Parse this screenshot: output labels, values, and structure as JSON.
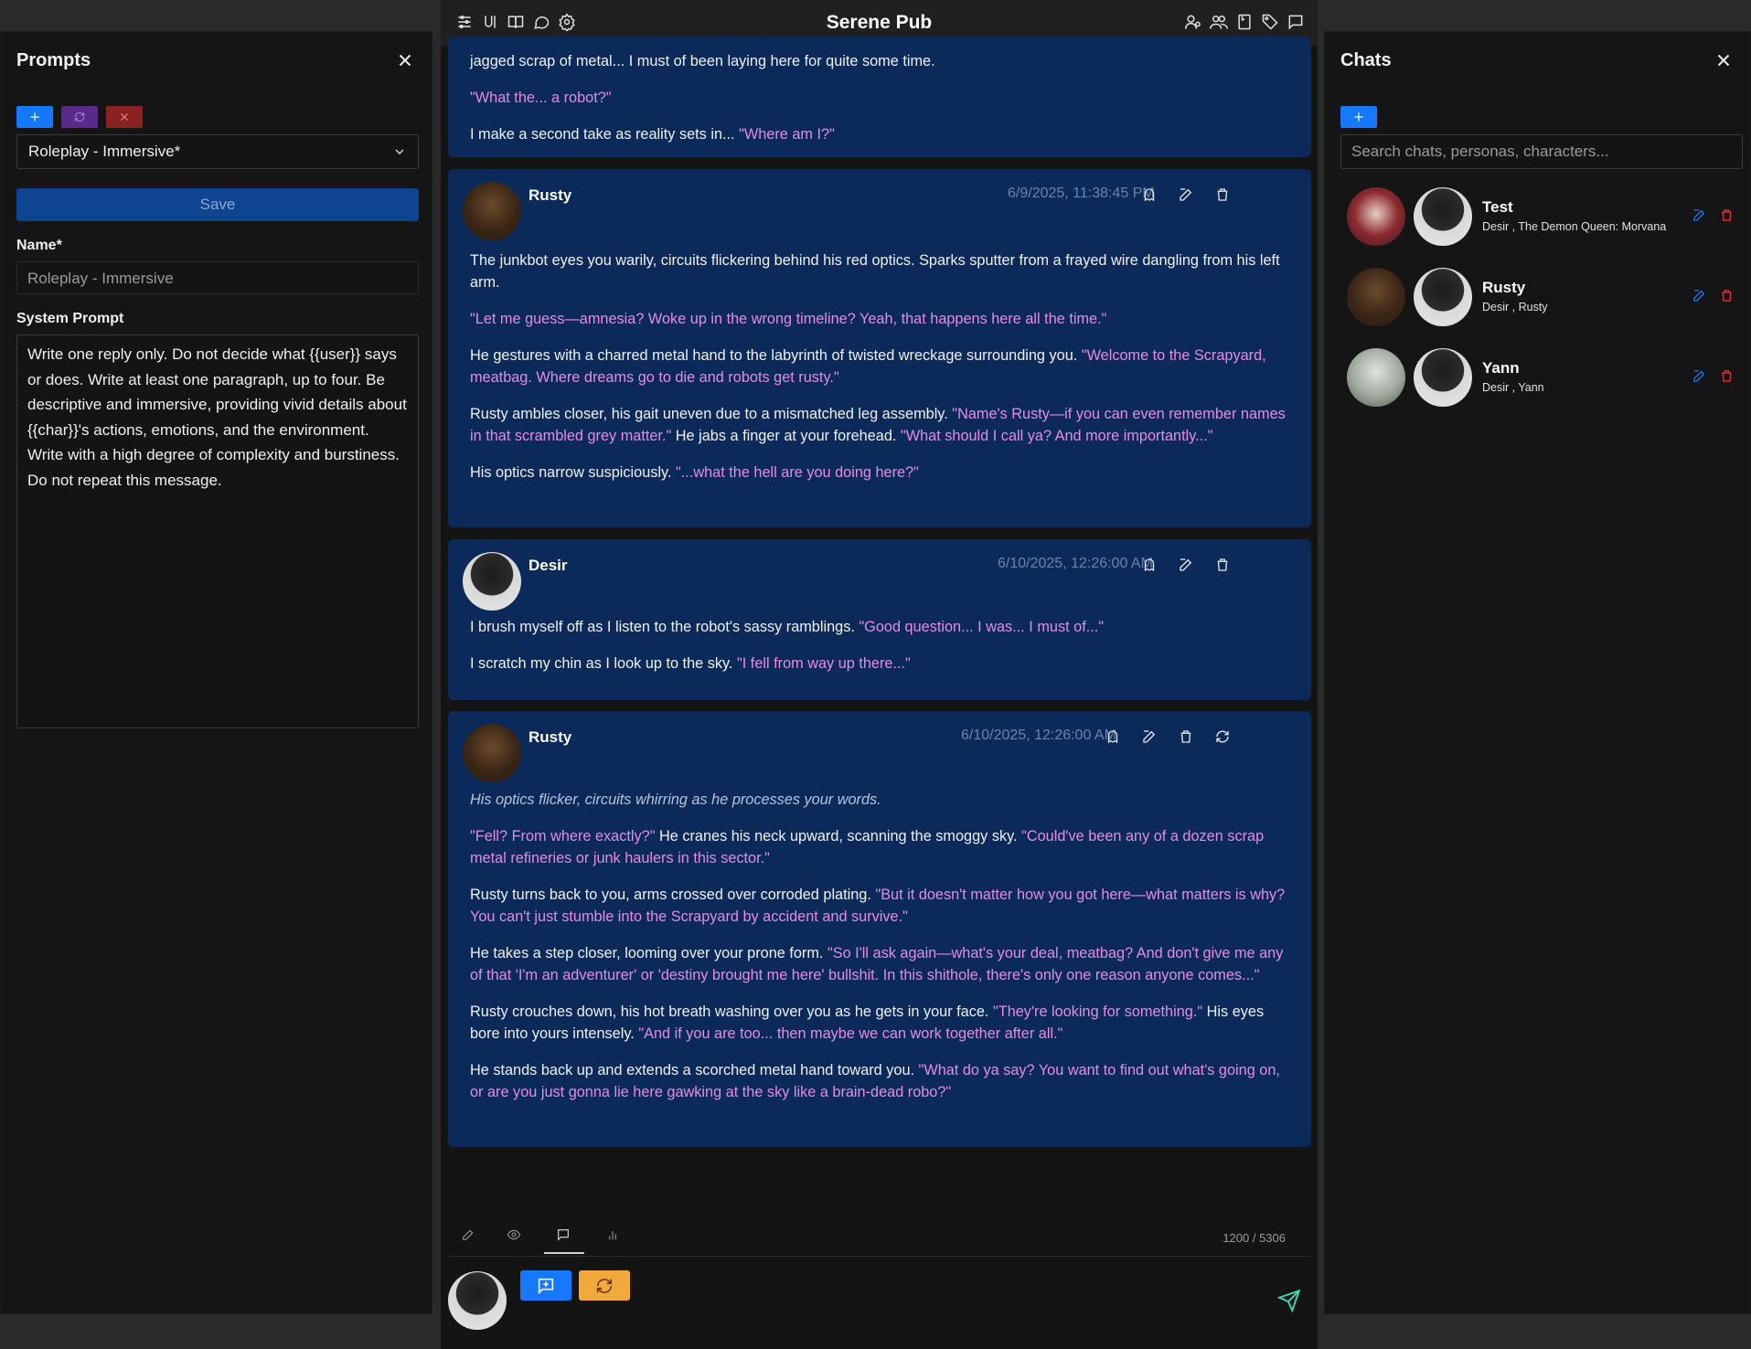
{
  "app": {
    "title": "Serene Pub"
  },
  "left_panel": {
    "title": "Prompts",
    "selected_prompt": "Roleplay - Immersive*",
    "save_label": "Save",
    "name_label": "Name*",
    "name_value": "Roleplay - Immersive",
    "system_prompt_label": "System Prompt",
    "system_prompt_value": "Write one reply only. Do not decide what {{user}} says or does. Write at least one paragraph, up to four. Be descriptive and immersive, providing vivid details about {{char}}'s actions, emotions, and the environment. Write with a high degree of complexity and burstiness. Do not repeat this message."
  },
  "messages": [
    {
      "partial_top": true,
      "paragraphs": [
        [
          {
            "t": "jagged scrap of metal... I must of been laying here for quite some time.",
            "c": ""
          }
        ],
        [
          {
            "t": "\"What the... a robot?\"",
            "c": "q"
          }
        ],
        [
          {
            "t": "I make a second take as reality sets in... ",
            "c": ""
          },
          {
            "t": "\"Where am I?\"",
            "c": "q"
          }
        ]
      ]
    },
    {
      "author": "Rusty",
      "timestamp": "6/9/2025, 11:38:45 PM",
      "paragraphs": [
        [
          {
            "t": "The junkbot eyes you warily, circuits flickering behind his red optics. Sparks sputter from a frayed wire dangling from his left arm.",
            "c": ""
          }
        ],
        [
          {
            "t": "\"Let me guess—amnesia? Woke up in the wrong timeline? Yeah, that happens here all the time.\"",
            "c": "q"
          }
        ],
        [
          {
            "t": "He gestures with a charred metal hand to the labyrinth of twisted wreckage surrounding you. ",
            "c": ""
          },
          {
            "t": "\"Welcome to the Scrapyard, meatbag. Where dreams go to die and robots get rusty.\"",
            "c": "q"
          }
        ],
        [
          {
            "t": "Rusty ambles closer, his gait uneven due to a mismatched leg assembly. ",
            "c": ""
          },
          {
            "t": "\"Name's Rusty—if you can even remember names in that scrambled grey matter.\"",
            "c": "q"
          },
          {
            "t": " He jabs a finger at your forehead. ",
            "c": ""
          },
          {
            "t": "\"What should I call ya? And more importantly...\"",
            "c": "q"
          }
        ],
        [
          {
            "t": "His optics narrow suspiciously. ",
            "c": ""
          },
          {
            "t": "\"...what the hell are you doing here?\"",
            "c": "q"
          }
        ]
      ]
    },
    {
      "author": "Desir",
      "timestamp": "6/10/2025, 12:26:00 AM",
      "paragraphs": [
        [
          {
            "t": "I brush myself off as I listen to the robot's sassy ramblings. ",
            "c": ""
          },
          {
            "t": "\"Good question... I was... I must of...\"",
            "c": "q"
          }
        ],
        [
          {
            "t": "I scratch my chin as I look up to the sky. ",
            "c": ""
          },
          {
            "t": "\"I fell from way up there...\"",
            "c": "q"
          }
        ]
      ]
    },
    {
      "author": "Rusty",
      "timestamp": "6/10/2025, 12:26:00 AM",
      "paragraphs": [
        [
          {
            "t": "His optics flicker, circuits whirring as he processes your words.",
            "c": "it"
          }
        ],
        [
          {
            "t": "\"Fell? From where exactly?\"",
            "c": "q"
          },
          {
            "t": " He cranes his neck upward, scanning the smoggy sky. ",
            "c": ""
          },
          {
            "t": "\"Could've been any of a dozen scrap metal refineries or junk haulers in this sector.\"",
            "c": "q"
          }
        ],
        [
          {
            "t": "Rusty turns back to you, arms crossed over corroded plating. ",
            "c": ""
          },
          {
            "t": "\"But it doesn't matter how you got here—what matters is why? You can't just stumble into the Scrapyard by accident and survive.\"",
            "c": "q"
          }
        ],
        [
          {
            "t": "He takes a step closer, looming over your prone form. ",
            "c": ""
          },
          {
            "t": "\"So I'll ask again—what's your deal, meatbag? And don't give me any of that 'I'm an adventurer' or 'destiny brought me here' bullshit. In this shithole, there's only one reason anyone comes...\"",
            "c": "q"
          }
        ],
        [
          {
            "t": "Rusty crouches down, his hot breath washing over you as he gets in your face. ",
            "c": ""
          },
          {
            "t": "\"They're looking for something.\"",
            "c": "q"
          },
          {
            "t": " His eyes bore into yours intensely. ",
            "c": ""
          },
          {
            "t": "\"And if you are too... then maybe we can work together after all.\"",
            "c": "q"
          }
        ],
        [
          {
            "t": "He stands back up and extends a scorched metal hand toward you. ",
            "c": ""
          },
          {
            "t": "\"What do ya say? You want to find out what's going on, or are you just gonna lie here gawking at the sky like a brain-dead robo?\"",
            "c": "q"
          }
        ]
      ]
    }
  ],
  "composer": {
    "token_count": "1200 / 5306"
  },
  "right_panel": {
    "title": "Chats",
    "search_placeholder": "Search chats, personas, characters...",
    "chats": [
      {
        "name": "Test",
        "meta": "Desir , The Demon Queen: Morvana"
      },
      {
        "name": "Rusty",
        "meta": "Desir , Rusty"
      },
      {
        "name": "Yann",
        "meta": "Desir , Yann"
      }
    ]
  },
  "colors": {
    "accent_blue": "#1677ff",
    "message_bg": "#0b2a5a",
    "quote_pink": "#e58be0",
    "send_green": "#3dd6b0",
    "regen_orange": "#f2a93b"
  }
}
